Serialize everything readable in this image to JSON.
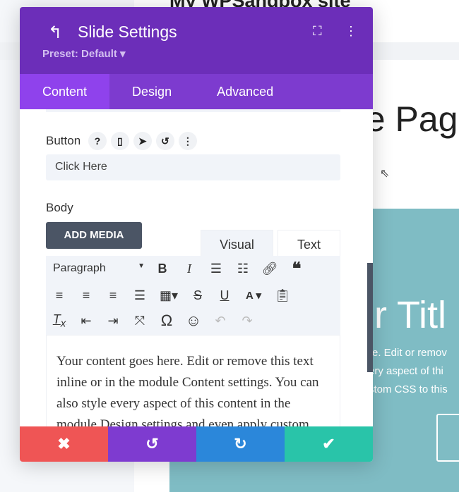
{
  "background": {
    "site_title": "My WPSandbox site",
    "page_title": "ne Pag",
    "slide_title": "ur Titl",
    "slide_text": [
      "re. Edit or remov",
      "ery aspect of thi",
      "stom CSS to this"
    ],
    "teal": "#7fbcc4"
  },
  "panel": {
    "back_icon": "undo-arrow-icon",
    "title": "Slide Settings",
    "preset": "Preset: Default ▾",
    "tabs": [
      {
        "label": "Content",
        "active": true
      },
      {
        "label": "Design"
      },
      {
        "label": "Advanced"
      }
    ],
    "button_label": "Button",
    "button_value": "Click Here",
    "body_label": "Body",
    "add_media": "ADD MEDIA",
    "editor_tabs": [
      "Visual",
      "Text"
    ],
    "format": "Paragraph",
    "content": "Your content goes here. Edit or remove this text inline or in the module Content settings. You can also style every aspect of this content in the module Design settings and even apply custom CSS to this text in the module Advanced settings.",
    "colors": {
      "header": "#6c2eb9",
      "tabs": "#7d3bcf",
      "active_tab": "#8f42ec",
      "cancel": "#ef5555",
      "undo": "#7e3bd0",
      "redo": "#2b87da",
      "save": "#29c4a9"
    }
  }
}
